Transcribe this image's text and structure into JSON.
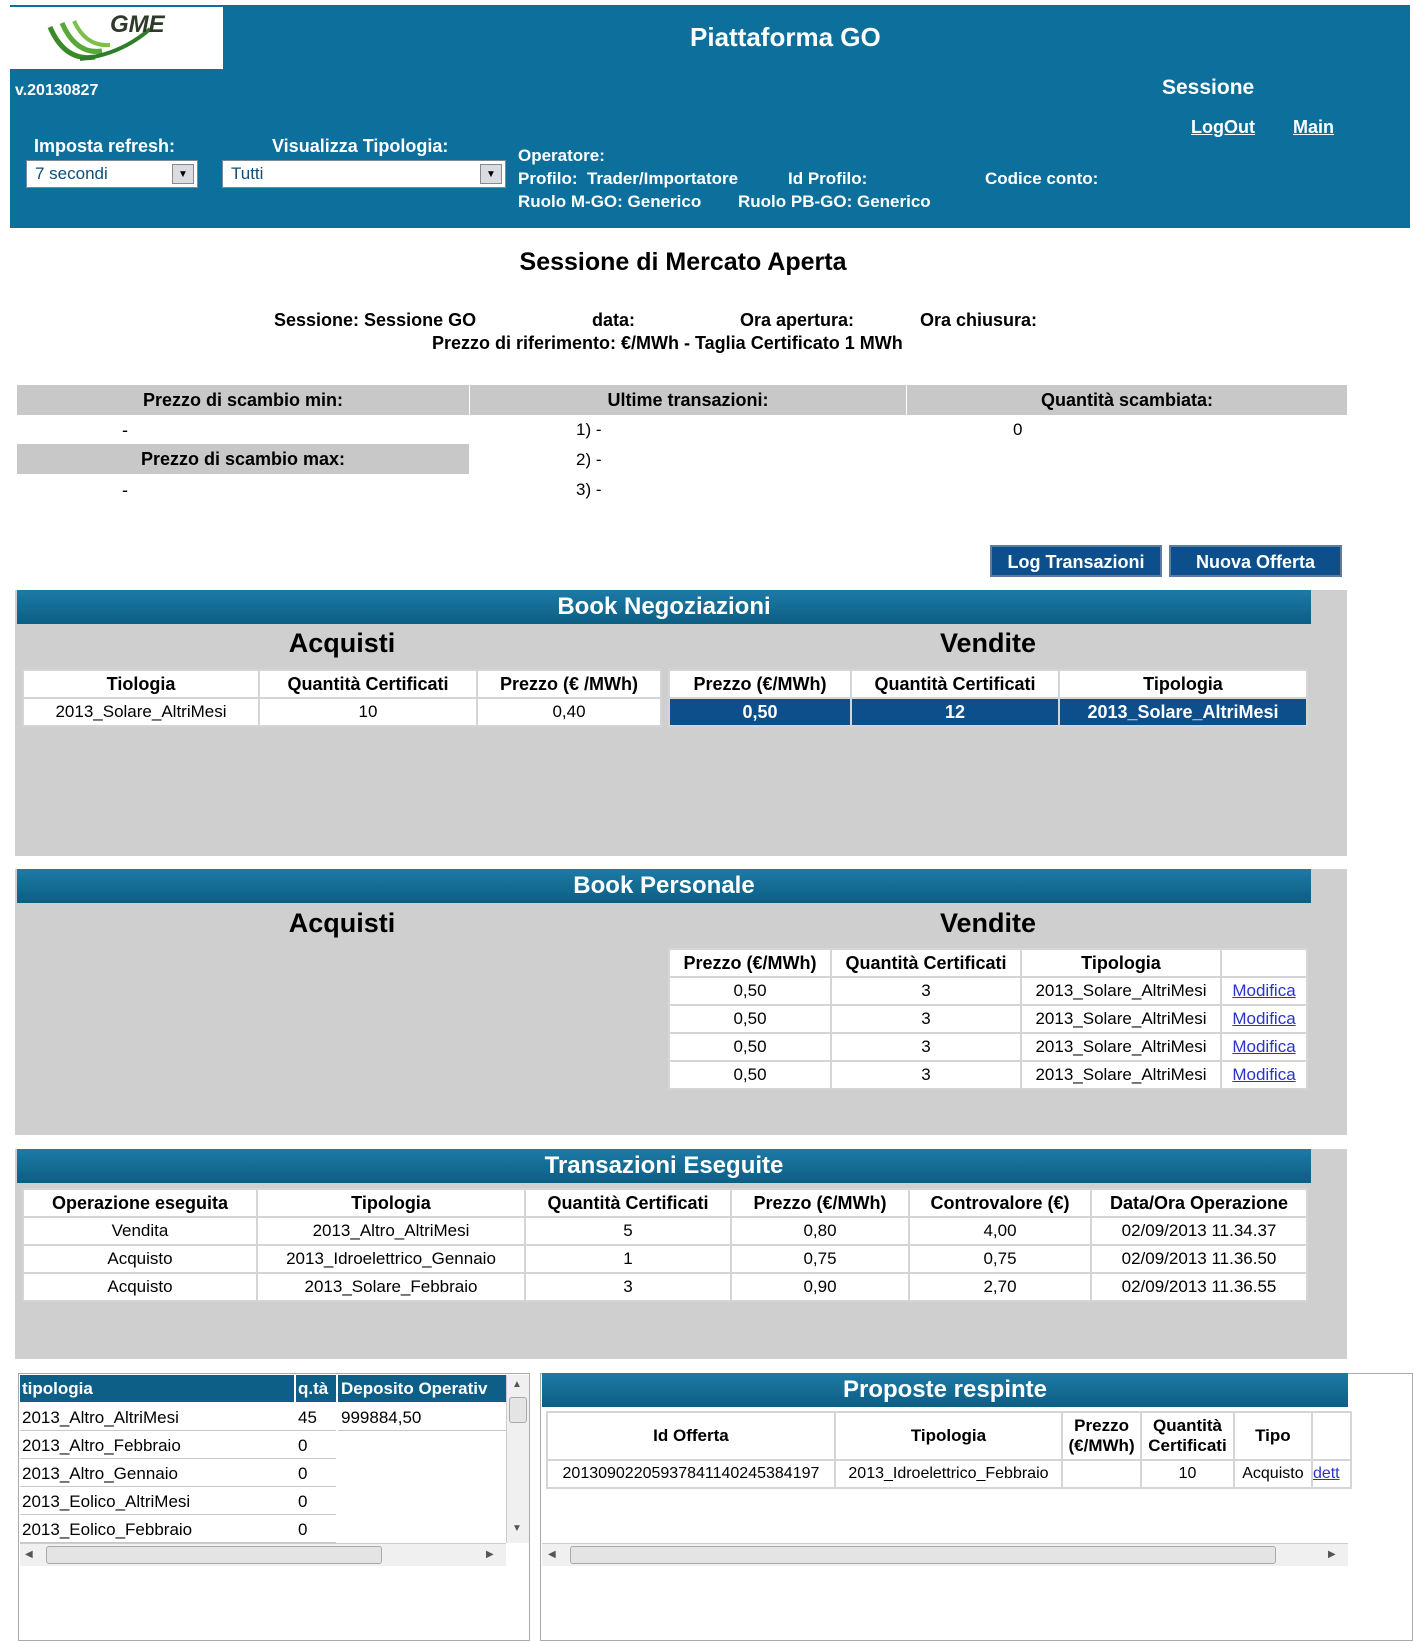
{
  "header": {
    "logo_text": "GME",
    "title": "Piattaforma GO",
    "version": "v.20130827",
    "sessione_label": "Sessione",
    "logout": "LogOut",
    "main": "Main",
    "refresh_label": "Imposta refresh:",
    "refresh_value": "7 secondi",
    "tipologia_label": "Visualizza Tipologia:",
    "tipologia_value": "Tutti",
    "operatore": "Operatore:",
    "profilo": "Profilo:  Trader/Importatore",
    "id_profilo": "Id Profilo:",
    "codice_conto": "Codice conto:",
    "ruolo_mgo": "Ruolo M-GO: Generico",
    "ruolo_pbgo": "Ruolo PB-GO: Generico"
  },
  "session": {
    "title": "Sessione di Mercato Aperta",
    "sessione": "Sessione: Sessione GO",
    "data": "data:",
    "ora_apertura": "Ora apertura:",
    "ora_chiusura": "Ora chiusura:",
    "riferimento": "Prezzo di riferimento: €/MWh - Taglia Certificato 1 MWh"
  },
  "stats": {
    "min_label": "Prezzo di scambio min:",
    "min_value": "-",
    "max_label": "Prezzo di scambio max:",
    "max_value": "-",
    "ultime_label": "Ultime transazioni:",
    "ultime": [
      "1) -",
      "2) -",
      "3) -"
    ],
    "quantita_label": "Quantità scambiata:",
    "quantita_value": "0"
  },
  "buttons": {
    "log": "Log Transazioni",
    "nuova": "Nuova Offerta"
  },
  "book_neg": {
    "title": "Book Negoziazioni",
    "acquisti": "Acquisti",
    "vendite": "Vendite",
    "acq_headers": [
      "Tiologia",
      "Quantità Certificati",
      "Prezzo (€ /MWh)"
    ],
    "acq_row": [
      "2013_Solare_AltriMesi",
      "10",
      "0,40"
    ],
    "ven_headers": [
      "Prezzo (€/MWh)",
      "Quantità Certificati",
      "Tipologia"
    ],
    "ven_row": [
      "0,50",
      "12",
      "2013_Solare_AltriMesi"
    ]
  },
  "book_pers": {
    "title": "Book Personale",
    "acquisti": "Acquisti",
    "vendite": "Vendite",
    "headers": [
      "Prezzo (€/MWh)",
      "Quantità Certificati",
      "Tipologia"
    ],
    "modifica": "Modifica",
    "rows": [
      [
        "0,50",
        "3",
        "2013_Solare_AltriMesi"
      ],
      [
        "0,50",
        "3",
        "2013_Solare_AltriMesi"
      ],
      [
        "0,50",
        "3",
        "2013_Solare_AltriMesi"
      ],
      [
        "0,50",
        "3",
        "2013_Solare_AltriMesi"
      ]
    ]
  },
  "transazioni": {
    "title": "Transazioni Eseguite",
    "headers": [
      "Operazione eseguita",
      "Tipologia",
      "Quantità Certificati",
      "Prezzo (€/MWh)",
      "Controvalore (€)",
      "Data/Ora Operazione"
    ],
    "rows": [
      [
        "Vendita",
        "2013_Altro_AltriMesi",
        "5",
        "0,80",
        "4,00",
        "02/09/2013 11.34.37"
      ],
      [
        "Acquisto",
        "2013_Idroelettrico_Gennaio",
        "1",
        "0,75",
        "0,75",
        "02/09/2013 11.36.50"
      ],
      [
        "Acquisto",
        "2013_Solare_Febbraio",
        "3",
        "0,90",
        "2,70",
        "02/09/2013 11.36.55"
      ]
    ]
  },
  "deposito": {
    "headers": [
      "tipologia",
      "q.tà",
      "Deposito Operativ"
    ],
    "deposito_value": "999884,50",
    "rows": [
      [
        "2013_Altro_AltriMesi",
        "45"
      ],
      [
        "2013_Altro_Febbraio",
        "0"
      ],
      [
        "2013_Altro_Gennaio",
        "0"
      ],
      [
        "2013_Eolico_AltriMesi",
        "0"
      ],
      [
        "2013_Eolico_Febbraio",
        "0"
      ]
    ]
  },
  "respinte": {
    "title": "Proposte respinte",
    "headers": [
      "Id Offerta",
      "Tipologia",
      "Prezzo (€/MWh)",
      "Quantità Certificati",
      "Tipo"
    ],
    "row": [
      "201309022059378411402453841​97",
      "2013_Idroelettrico_Febbraio",
      "",
      "10",
      "Acquisto"
    ],
    "link": "dett"
  }
}
